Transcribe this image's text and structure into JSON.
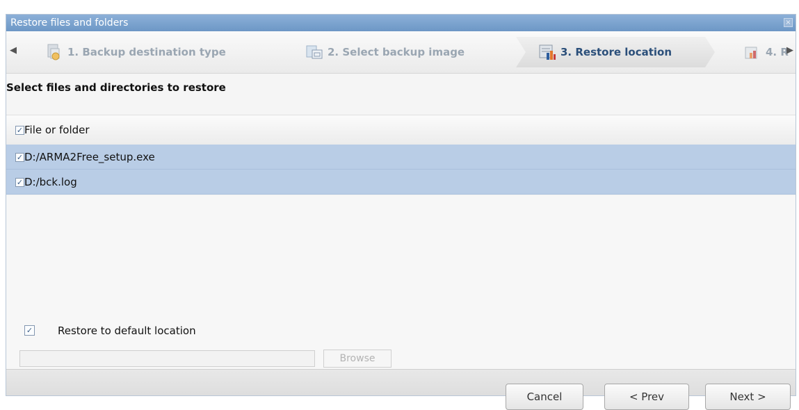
{
  "window": {
    "title": "Restore files and folders",
    "close_glyph": "×"
  },
  "steps": [
    {
      "label": "1. Backup destination type",
      "icon": "folder-backup-icon",
      "state": "done"
    },
    {
      "label": "2. Select backup image",
      "icon": "select-image-icon",
      "state": "done"
    },
    {
      "label": "3. Restore location",
      "icon": "restore-location-icon",
      "state": "active"
    },
    {
      "label": "4. R",
      "icon": "summary-chart-icon",
      "state": "upcoming"
    }
  ],
  "nav": {
    "left_glyph": "◀",
    "right_glyph": "▶"
  },
  "section": {
    "title": "Select files and directories to restore"
  },
  "list": {
    "header": {
      "label": "File or folder",
      "checked": true
    },
    "rows": [
      {
        "path": "D:/ARMA2Free_setup.exe",
        "checked": true
      },
      {
        "path": "D:/bck.log",
        "checked": true
      }
    ]
  },
  "restore_default": {
    "label": "Restore to default location",
    "checked": true
  },
  "path_input": {
    "value": "",
    "placeholder": ""
  },
  "browse": {
    "label": "Browse",
    "enabled": false
  },
  "footer": {
    "cancel_label": "Cancel",
    "prev_label": "< Prev",
    "next_label": "Next >"
  },
  "checkmark": "✓",
  "colors": {
    "accent": "#2b4f7a",
    "titlebar": "#7ea4cf",
    "selected_row": "#b9cde6"
  }
}
